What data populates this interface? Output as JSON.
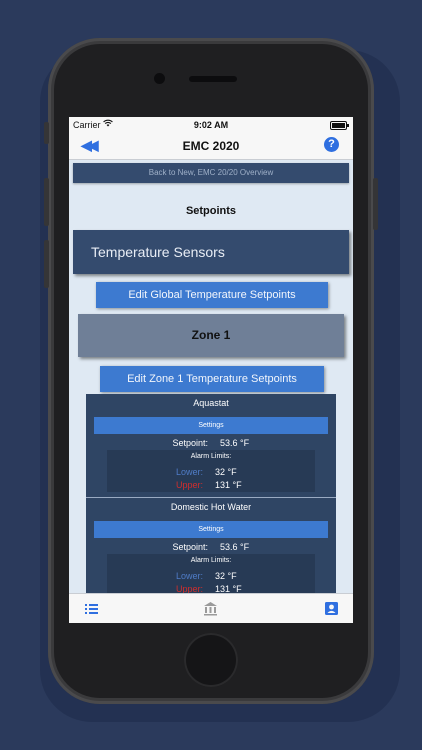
{
  "status_bar": {
    "carrier": "Carrier",
    "time": "9:02 AM"
  },
  "nav": {
    "title": "EMC 2020",
    "help": "?"
  },
  "links": {
    "back_overview": "Back to New, EMC 20/20 Overview"
  },
  "page": {
    "heading": "Setpoints"
  },
  "sections": {
    "temperature_sensors": "Temperature Sensors",
    "edit_global": "Edit Global Temperature Setpoints",
    "zone": "Zone 1",
    "edit_zone": "Edit Zone 1 Temperature Setpoints"
  },
  "devices": [
    {
      "name": "Aquastat",
      "settings_label": "Settings",
      "setpoint_label": "Setpoint:",
      "setpoint_value": "53.6 °F",
      "alarm_label": "Alarm Limits:",
      "lower_label": "Lower:",
      "lower_value": "32 °F",
      "upper_label": "Upper:",
      "upper_value": "131 °F"
    },
    {
      "name": "Domestic Hot Water",
      "settings_label": "Settings",
      "setpoint_label": "Setpoint:",
      "setpoint_value": "53.6 °F",
      "alarm_label": "Alarm Limits:",
      "lower_label": "Lower:",
      "lower_value": "32 °F",
      "upper_label": "Upper:",
      "upper_value": "131 °F"
    }
  ],
  "tabbar": {
    "icons": [
      "list-icon",
      "bank-icon",
      "account-icon"
    ]
  },
  "colors": {
    "accent": "#3d7ad0",
    "card": "#2f4564",
    "lower": "#4f7cc7",
    "upper": "#cf2e2e",
    "ios_blue": "#2f6fe0"
  }
}
